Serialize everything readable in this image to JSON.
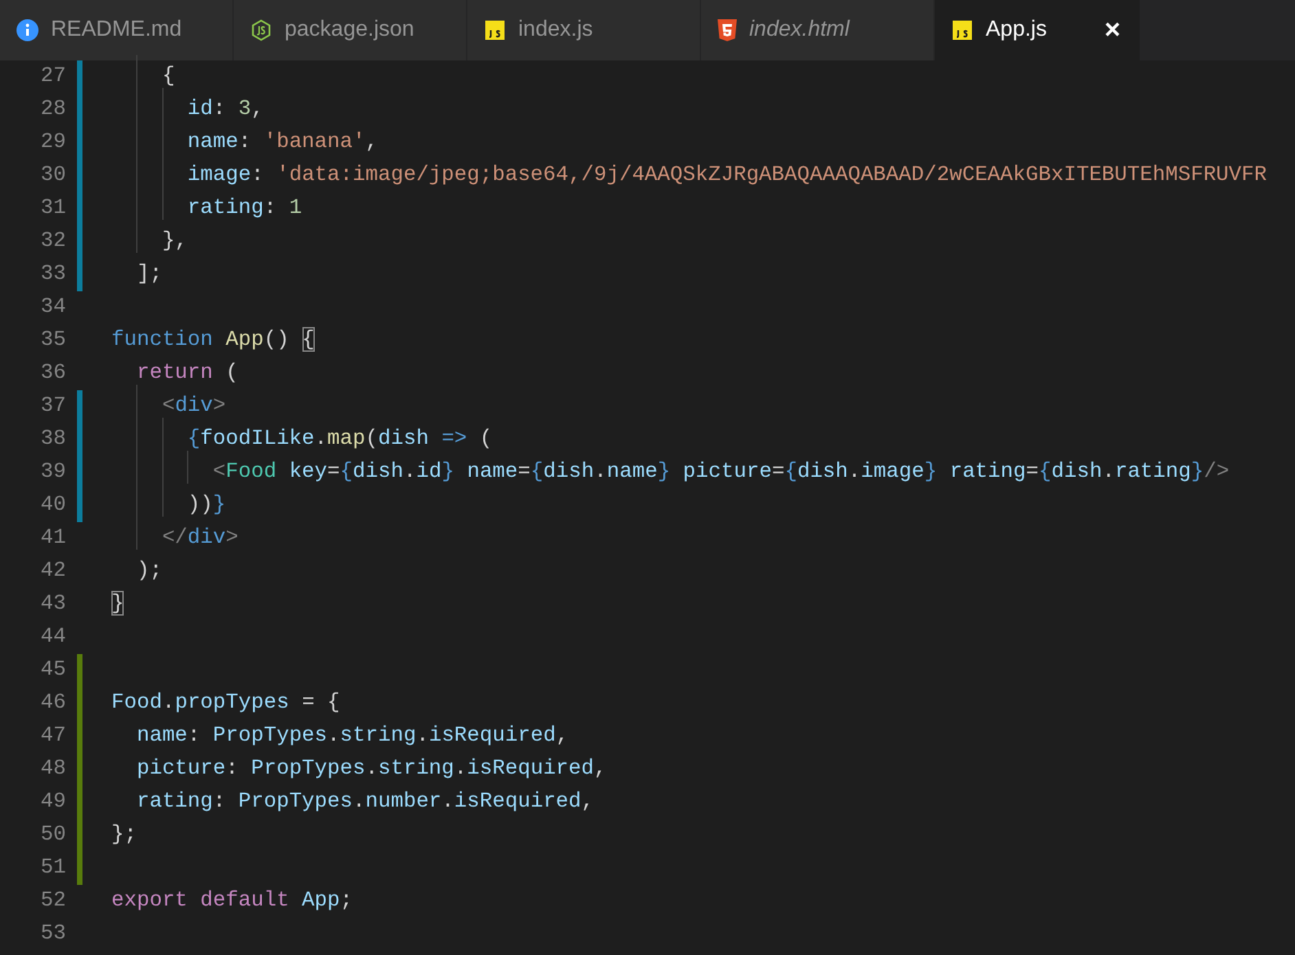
{
  "tabs": [
    {
      "label": "README.md",
      "kind": "info",
      "selected": false,
      "preview": false
    },
    {
      "label": "package.json",
      "kind": "node",
      "selected": false,
      "preview": false
    },
    {
      "label": "index.js",
      "kind": "js",
      "selected": false,
      "preview": false
    },
    {
      "label": "index.html",
      "kind": "html",
      "selected": false,
      "preview": true
    },
    {
      "label": "App.js",
      "kind": "js",
      "selected": true,
      "preview": false,
      "close": "×"
    }
  ],
  "editor": {
    "lines": [
      {
        "number": "27",
        "modified": true,
        "added": false,
        "tokens": [
          {
            "kind": "plain",
            "text": "    {"
          }
        ]
      },
      {
        "number": "28",
        "modified": true,
        "added": false,
        "tokens": [
          {
            "kind": "variable",
            "text": "      id"
          },
          {
            "kind": "plain",
            "text": ": "
          },
          {
            "kind": "number",
            "text": "3"
          },
          {
            "kind": "plain",
            "text": ","
          }
        ]
      },
      {
        "number": "29",
        "modified": true,
        "added": false,
        "tokens": [
          {
            "kind": "variable",
            "text": "      name"
          },
          {
            "kind": "plain",
            "text": ": "
          },
          {
            "kind": "string",
            "text": "'banana'"
          },
          {
            "kind": "plain",
            "text": ","
          }
        ]
      },
      {
        "number": "30",
        "modified": true,
        "added": false,
        "tokens": [
          {
            "kind": "variable",
            "text": "      image"
          },
          {
            "kind": "plain",
            "text": ": "
          },
          {
            "kind": "string",
            "text": "'data:image/jpeg;base64,/9j/4AAQSkZJRgABAQAAAQABAAD/2wCEAAkGBxITEBUTEhMSFRUVFR"
          }
        ]
      },
      {
        "number": "31",
        "modified": true,
        "added": false,
        "tokens": [
          {
            "kind": "variable",
            "text": "      rating"
          },
          {
            "kind": "plain",
            "text": ": "
          },
          {
            "kind": "number",
            "text": "1"
          }
        ]
      },
      {
        "number": "32",
        "modified": true,
        "added": false,
        "tokens": [
          {
            "kind": "plain",
            "text": "    },"
          }
        ]
      },
      {
        "number": "33",
        "modified": true,
        "added": false,
        "tokens": [
          {
            "kind": "plain",
            "text": "  ];"
          }
        ]
      },
      {
        "number": "34",
        "modified": false,
        "added": false
      },
      {
        "number": "35",
        "modified": false,
        "added": false,
        "tokens": [
          {
            "kind": "keyword",
            "text": "function "
          },
          {
            "kind": "function",
            "text": "App"
          },
          {
            "kind": "plain",
            "text": "() "
          },
          {
            "kind": "bracket-match",
            "text": "{"
          }
        ]
      },
      {
        "number": "36",
        "modified": false,
        "added": false,
        "tokens": [
          {
            "kind": "control",
            "text": "  return"
          },
          {
            "kind": "plain",
            "text": " ("
          }
        ]
      },
      {
        "number": "37",
        "modified": true,
        "added": false,
        "tokens": [
          {
            "kind": "tag-bracket",
            "text": "    <"
          },
          {
            "kind": "tag",
            "text": "div"
          },
          {
            "kind": "tag-bracket",
            "text": ">"
          }
        ]
      },
      {
        "number": "38",
        "modified": true,
        "added": false,
        "tokens": [
          {
            "kind": "keyword",
            "text": "      {"
          },
          {
            "kind": "variable",
            "text": "foodILike"
          },
          {
            "kind": "plain",
            "text": "."
          },
          {
            "kind": "function",
            "text": "map"
          },
          {
            "kind": "plain",
            "text": "("
          },
          {
            "kind": "variable",
            "text": "dish "
          },
          {
            "kind": "keyword",
            "text": "=> "
          },
          {
            "kind": "plain",
            "text": "("
          }
        ]
      },
      {
        "number": "39",
        "modified": true,
        "added": false,
        "tokens": [
          {
            "kind": "tag-bracket",
            "text": "        <"
          },
          {
            "kind": "component",
            "text": "Food "
          },
          {
            "kind": "variable",
            "text": "key"
          },
          {
            "kind": "plain",
            "text": "="
          },
          {
            "kind": "keyword",
            "text": "{"
          },
          {
            "kind": "variable",
            "text": "dish"
          },
          {
            "kind": "plain",
            "text": "."
          },
          {
            "kind": "variable",
            "text": "id"
          },
          {
            "kind": "keyword",
            "text": "} "
          },
          {
            "kind": "variable",
            "text": "name"
          },
          {
            "kind": "plain",
            "text": "="
          },
          {
            "kind": "keyword",
            "text": "{"
          },
          {
            "kind": "variable",
            "text": "dish"
          },
          {
            "kind": "plain",
            "text": "."
          },
          {
            "kind": "variable",
            "text": "name"
          },
          {
            "kind": "keyword",
            "text": "} "
          },
          {
            "kind": "variable",
            "text": "picture"
          },
          {
            "kind": "plain",
            "text": "="
          },
          {
            "kind": "keyword",
            "text": "{"
          },
          {
            "kind": "variable",
            "text": "dish"
          },
          {
            "kind": "plain",
            "text": "."
          },
          {
            "kind": "variable",
            "text": "image"
          },
          {
            "kind": "keyword",
            "text": "} "
          },
          {
            "kind": "variable",
            "text": "rating"
          },
          {
            "kind": "plain",
            "text": "="
          },
          {
            "kind": "keyword",
            "text": "{"
          },
          {
            "kind": "variable",
            "text": "dish"
          },
          {
            "kind": "plain",
            "text": "."
          },
          {
            "kind": "variable",
            "text": "rating"
          },
          {
            "kind": "keyword",
            "text": "}"
          },
          {
            "kind": "tag-bracket",
            "text": "/>"
          }
        ]
      },
      {
        "number": "40",
        "modified": true,
        "added": false,
        "tokens": [
          {
            "kind": "plain",
            "text": "      ))"
          },
          {
            "kind": "keyword",
            "text": "}"
          }
        ]
      },
      {
        "number": "41",
        "modified": false,
        "added": false,
        "tokens": [
          {
            "kind": "tag-bracket",
            "text": "    </"
          },
          {
            "kind": "tag",
            "text": "div"
          },
          {
            "kind": "tag-bracket",
            "text": ">"
          }
        ]
      },
      {
        "number": "42",
        "modified": false,
        "added": false,
        "tokens": [
          {
            "kind": "plain",
            "text": "  );"
          }
        ]
      },
      {
        "number": "43",
        "modified": false,
        "added": false,
        "tokens": [
          {
            "kind": "bracket-match",
            "text": "}"
          }
        ]
      },
      {
        "number": "44",
        "modified": false,
        "added": false
      },
      {
        "number": "45",
        "modified": false,
        "added": true
      },
      {
        "number": "46",
        "modified": false,
        "added": true,
        "tokens": [
          {
            "kind": "variable",
            "text": "Food"
          },
          {
            "kind": "plain",
            "text": "."
          },
          {
            "kind": "variable",
            "text": "propTypes"
          },
          {
            "kind": "plain",
            "text": " = {"
          }
        ]
      },
      {
        "number": "47",
        "modified": false,
        "added": true,
        "tokens": [
          {
            "kind": "variable",
            "text": "  name"
          },
          {
            "kind": "plain",
            "text": ": "
          },
          {
            "kind": "variable",
            "text": "PropTypes"
          },
          {
            "kind": "plain",
            "text": "."
          },
          {
            "kind": "variable",
            "text": "string"
          },
          {
            "kind": "plain",
            "text": "."
          },
          {
            "kind": "variable",
            "text": "isRequired"
          },
          {
            "kind": "plain",
            "text": ","
          }
        ]
      },
      {
        "number": "48",
        "modified": false,
        "added": true,
        "tokens": [
          {
            "kind": "variable",
            "text": "  picture"
          },
          {
            "kind": "plain",
            "text": ": "
          },
          {
            "kind": "variable",
            "text": "PropTypes"
          },
          {
            "kind": "plain",
            "text": "."
          },
          {
            "kind": "variable",
            "text": "string"
          },
          {
            "kind": "plain",
            "text": "."
          },
          {
            "kind": "variable",
            "text": "isRequired"
          },
          {
            "kind": "plain",
            "text": ","
          }
        ]
      },
      {
        "number": "49",
        "modified": false,
        "added": true,
        "tokens": [
          {
            "kind": "variable",
            "text": "  rating"
          },
          {
            "kind": "plain",
            "text": ": "
          },
          {
            "kind": "variable",
            "text": "PropTypes"
          },
          {
            "kind": "plain",
            "text": "."
          },
          {
            "kind": "variable",
            "text": "number"
          },
          {
            "kind": "plain",
            "text": "."
          },
          {
            "kind": "variable",
            "text": "isRequired"
          },
          {
            "kind": "plain",
            "text": ","
          }
        ]
      },
      {
        "number": "50",
        "modified": false,
        "added": true,
        "tokens": [
          {
            "kind": "plain",
            "text": "};"
          }
        ]
      },
      {
        "number": "51",
        "modified": false,
        "added": true
      },
      {
        "number": "52",
        "modified": false,
        "added": false,
        "tokens": [
          {
            "kind": "control",
            "text": "export "
          },
          {
            "kind": "control",
            "text": "default "
          },
          {
            "kind": "variable",
            "text": "App"
          },
          {
            "kind": "plain",
            "text": ";"
          }
        ]
      },
      {
        "number": "53",
        "modified": false,
        "added": false
      }
    ]
  }
}
